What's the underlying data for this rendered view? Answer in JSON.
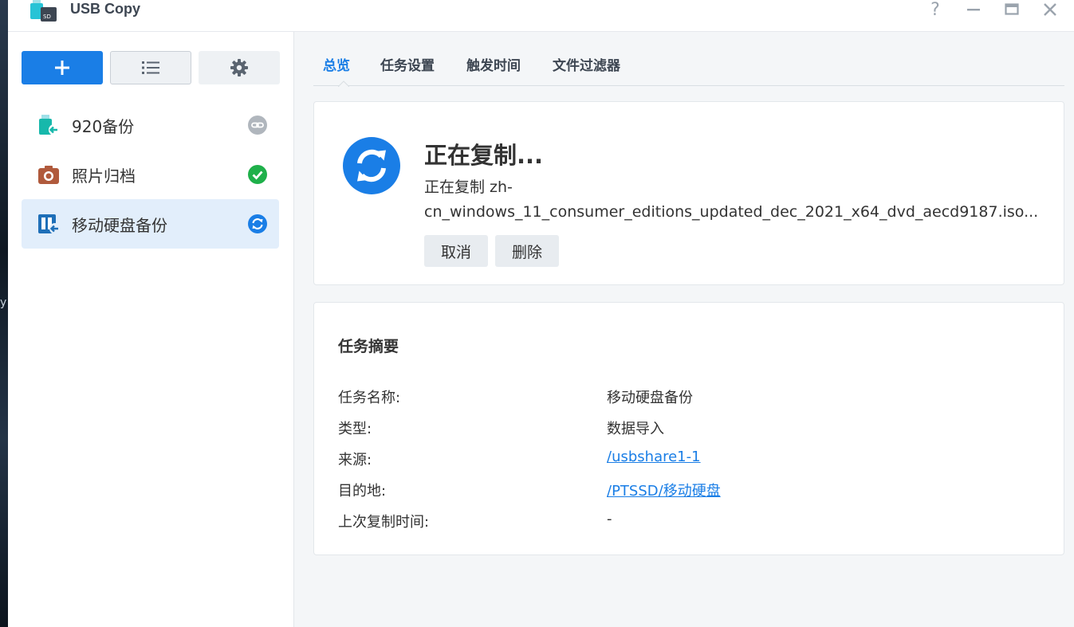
{
  "app": {
    "title": "USB Copy"
  },
  "window_controls": {
    "help_symbol": "?",
    "minimize_icon": "minimize-icon",
    "maximize_icon": "maximize-icon",
    "close_icon": "close-icon"
  },
  "toolbar": {
    "add_icon": "plus-icon",
    "list_icon": "list-icon",
    "settings_icon": "gear-icon"
  },
  "tasks": [
    {
      "label": "920备份",
      "icon": "usb-device-icon",
      "status": "link-icon",
      "status_color": "#b0b6bd"
    },
    {
      "label": "照片归档",
      "icon": "camera-icon",
      "status": "check-circle-icon",
      "status_color": "#1fb04a"
    },
    {
      "label": "移动硬盘备份",
      "icon": "drive-import-icon",
      "status": "sync-icon",
      "status_color": "#1a7ee6",
      "active": true
    }
  ],
  "tabs": [
    {
      "label": "总览",
      "active": true
    },
    {
      "label": "任务设置"
    },
    {
      "label": "触发时间"
    },
    {
      "label": "文件过滤器"
    }
  ],
  "status": {
    "title": "正在复制...",
    "detail_line1": "正在复制 zh-",
    "detail_line2": "cn_windows_11_consumer_editions_updated_dec_2021_x64_dvd_aecd9187.iso...",
    "cancel_label": "取消",
    "delete_label": "删除"
  },
  "summary": {
    "title": "任务摘要",
    "rows": [
      {
        "label": "任务名称:",
        "value": "移动硬盘备份"
      },
      {
        "label": "类型:",
        "value": "数据导入"
      },
      {
        "label": "来源:",
        "value": "/usbshare1-1"
      },
      {
        "label": "目的地:",
        "value": "/PTSSD/移动硬盘"
      },
      {
        "label": "上次复制时间:",
        "value": "-"
      }
    ]
  },
  "background": {
    "peek_text": "y"
  },
  "colors": {
    "accent": "#1a7ee6",
    "success": "#1fb04a",
    "muted": "#b0b6bd"
  }
}
